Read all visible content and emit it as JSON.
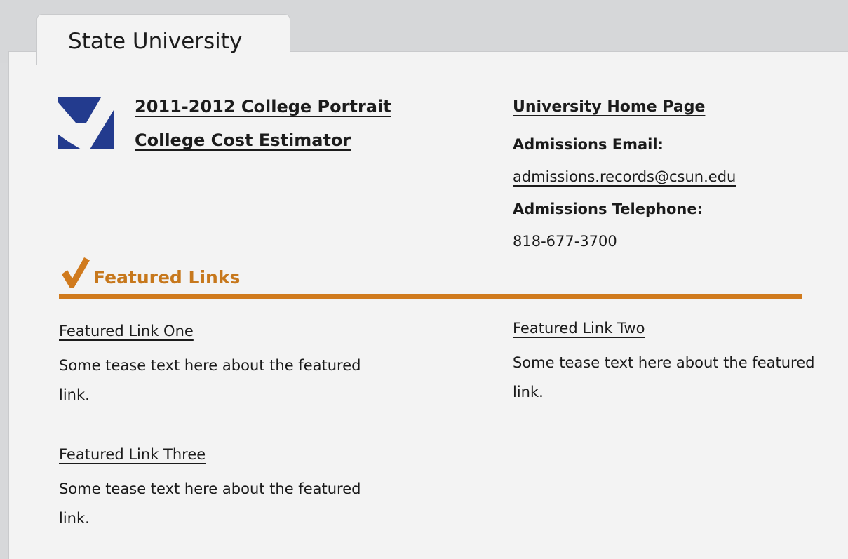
{
  "tab": {
    "label": "State University"
  },
  "header_links": {
    "portrait": "2011-2012 College Portrait",
    "cost_estimator": "College Cost Estimator"
  },
  "contact": {
    "home_page": "University Home Page",
    "email_label": "Admissions Email:",
    "email": "admissions.records@csun.edu",
    "telephone_label": "Admissions Telephone:",
    "telephone": "818-677-3700"
  },
  "featured": {
    "heading": "Featured Links",
    "links": [
      {
        "title": "Featured Link One",
        "tease": "Some tease text here about the featured link."
      },
      {
        "title": "Featured Link Two",
        "tease": "Some tease text here about the featured link."
      },
      {
        "title": "Featured Link Three",
        "tease": "Some tease text here about the featured link."
      }
    ]
  },
  "colors": {
    "logo_blue": "#233b8e",
    "accent_orange": "#d07a1d",
    "panel_bg": "#f3f3f3",
    "frame_bg": "#d6d7d9"
  },
  "icons": {
    "logo": "checkmark-logo-icon",
    "featured": "checkmark-icon"
  }
}
